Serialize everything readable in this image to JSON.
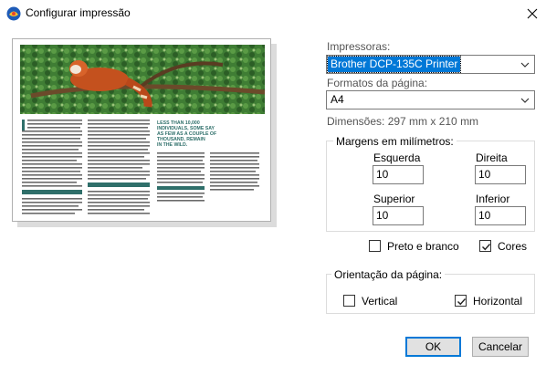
{
  "window": {
    "title": "Configurar impressão"
  },
  "preview": {
    "headline": "LESS THAN 10,000 INDIVIDUALS, SOME SAY AS FEW AS A COUPLE OF THOUSAND, REMAIN IN THE WILD."
  },
  "printers": {
    "label": "Impressoras:",
    "selected": "Brother DCP-135C Printer"
  },
  "page_format": {
    "label": "Formatos da página:",
    "selected": "A4",
    "dimensions": "Dimensões: 297 mm x 210 mm"
  },
  "margins": {
    "title": "Margens em milímetros:",
    "left_label": "Esquerda",
    "left_value": "10",
    "right_label": "Direita",
    "right_value": "10",
    "top_label": "Superior",
    "top_value": "10",
    "bottom_label": "Inferior",
    "bottom_value": "10"
  },
  "color": {
    "bw_label": "Preto e branco",
    "bw_checked": false,
    "color_label": "Cores",
    "color_checked": true
  },
  "orientation": {
    "title": "Orientação da página:",
    "vertical_label": "Vertical",
    "vertical_checked": false,
    "horizontal_label": "Horizontal",
    "horizontal_checked": true
  },
  "buttons": {
    "ok": "OK",
    "cancel": "Cancelar"
  },
  "colors": {
    "accent": "#0078d7",
    "photo_green": "#3f7d34",
    "panda_orange": "#c4511e",
    "teal_box": "#2f6f6a"
  }
}
